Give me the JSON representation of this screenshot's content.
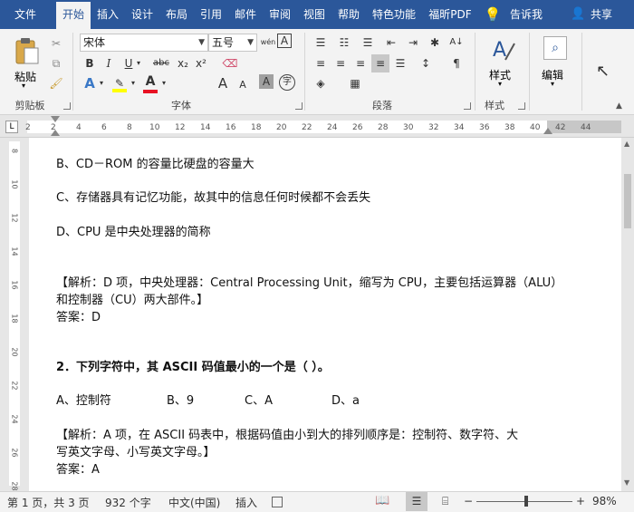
{
  "tabs": {
    "file": "文件",
    "home": "开始",
    "insert": "插入",
    "design": "设计",
    "layout": "布局",
    "references": "引用",
    "mailings": "邮件",
    "review": "审阅",
    "view": "视图",
    "help": "帮助",
    "features": "特色功能",
    "foxit_pdf": "福昕PDF",
    "tell_me": "告诉我",
    "share": "共享"
  },
  "ribbon": {
    "clipboard": {
      "paste": "粘贴",
      "label": "剪贴板"
    },
    "font": {
      "label": "字体",
      "font_name": "宋体",
      "font_size": "五号",
      "bold": "B",
      "italic": "I",
      "underline": "U",
      "strike": "abc",
      "subscript": "x₂",
      "superscript": "x²",
      "font_color_a": "A",
      "grow_a": "A",
      "shrink_a": "A",
      "phonetic": "wén",
      "enclosed": "字"
    },
    "paragraph": {
      "label": "段落"
    },
    "styles": {
      "label": "样式",
      "button": "样式"
    },
    "editing": {
      "label": "编辑",
      "button": "编辑"
    }
  },
  "ruler": {
    "ticks": [
      "2",
      "2",
      "4",
      "6",
      "8",
      "10",
      "12",
      "14",
      "16",
      "18",
      "20",
      "22",
      "24",
      "26",
      "28",
      "30",
      "32",
      "34",
      "36",
      "38",
      "40",
      "42",
      "44"
    ],
    "vticks": [
      "8",
      "10",
      "12",
      "14",
      "16",
      "18",
      "20",
      "22",
      "24",
      "26",
      "28"
    ]
  },
  "document": {
    "lines": [
      "B、CD－ROM 的容量比硬盘的容量大",
      "C、存储器具有记忆功能，故其中的信息任何时候都不会丢失",
      "D、CPU 是中央处理器的简称",
      "【解析：D 项，中央处理器：Central Processing Unit，缩写为 CPU，主要包括运算器（ALU）",
      "和控制器（CU）两大部件。】",
      "答案：D",
      "2．下列字符中，其 ASCII 码值最小的一个是（ ）。",
      "A、控制符",
      "B、9",
      "C、A",
      "D、a",
      "【解析：A 项，在 ASCII 码表中，根据码值由小到大的排列顺序是：控制符、数字符、大",
      "写英文字母、小写英文字母。】",
      "答案：A"
    ]
  },
  "status": {
    "page": "第 1 页，共 3 页",
    "words": "932 个字",
    "language": "中文(中国)",
    "mode": "插入",
    "zoom_minus": "−",
    "zoom_plus": "+",
    "zoom": "98%"
  },
  "colors": {
    "brand": "#2b579a",
    "ribbon_bg": "#f3f3f3",
    "highlight": "#ffff00",
    "font_color": "#e81123"
  }
}
